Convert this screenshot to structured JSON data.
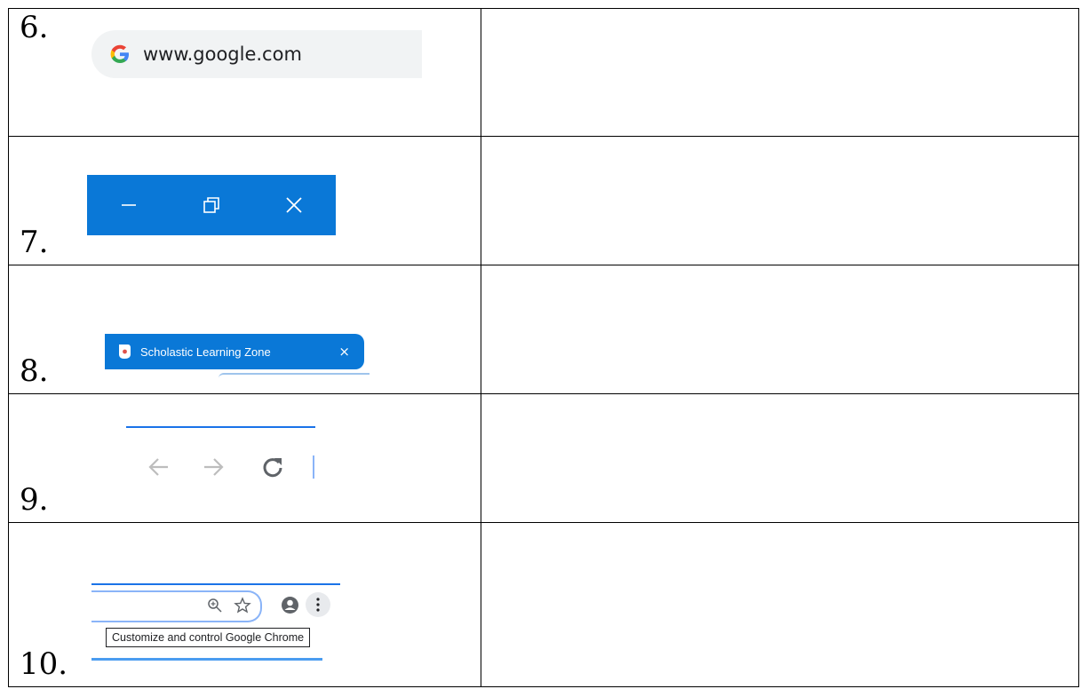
{
  "rows": [
    {
      "number": "6.",
      "omnibox_url": "www.google.com"
    },
    {
      "number": "7.",
      "controls": [
        "minimize-icon",
        "restore-icon",
        "close-icon"
      ]
    },
    {
      "number": "8.",
      "tab_title": "Scholastic Learning Zone",
      "tab_close": "×"
    },
    {
      "number": "9.",
      "nav_icons": [
        "back-arrow-icon",
        "forward-arrow-icon",
        "reload-icon"
      ]
    },
    {
      "number": "10.",
      "tooltip": "Customize and control Google Chrome",
      "toolbar_icons": [
        "zoom-icon",
        "bookmark-star-icon",
        "profile-icon",
        "menu-kebab-icon"
      ]
    }
  ],
  "colors": {
    "windows_blue": "#0a78d7",
    "chrome_blue": "#1a73e8",
    "omnibox_gray": "#f1f3f4"
  }
}
